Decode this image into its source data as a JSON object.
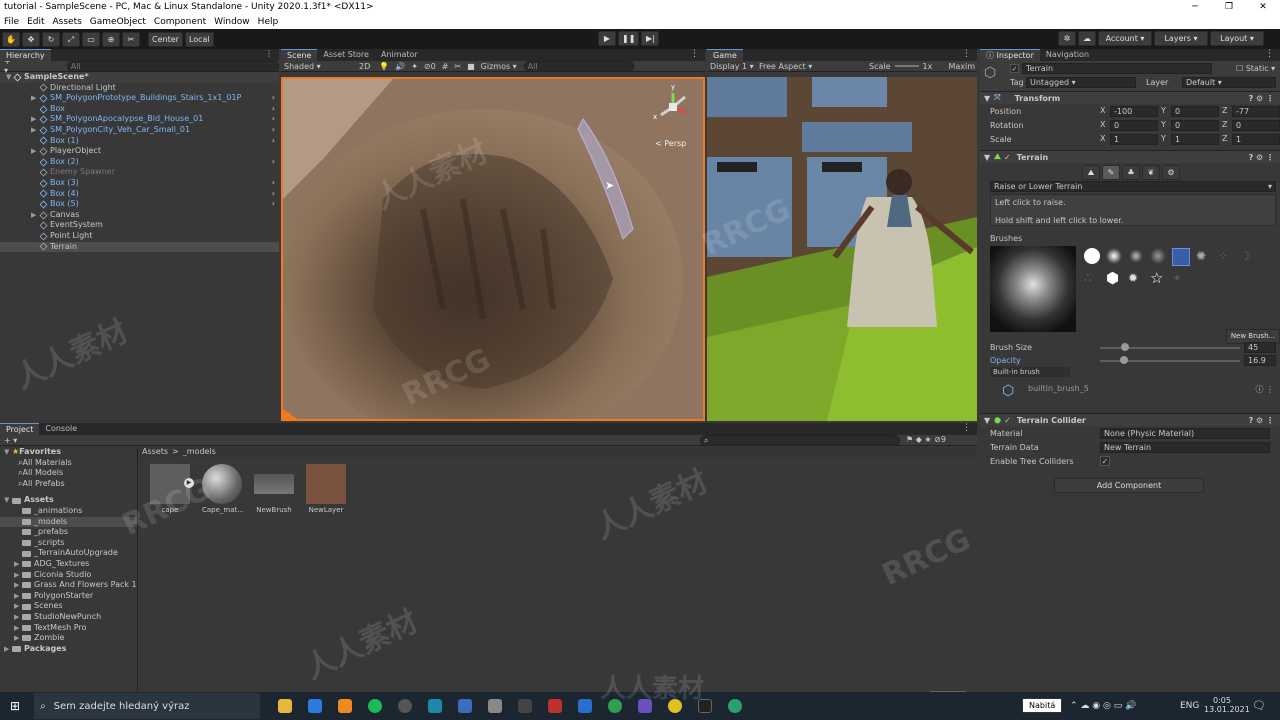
{
  "window": {
    "title": "tutorial - SampleScene - PC, Mac & Linux Standalone - Unity 2020.1.3f1* <DX11>",
    "controls": [
      "─",
      "❐",
      "✕"
    ]
  },
  "menu": [
    "File",
    "Edit",
    "Assets",
    "GameObject",
    "Component",
    "Window",
    "Help"
  ],
  "toolbar": {
    "pivot": "Center",
    "space": "Local",
    "account": "Account",
    "layers": "Layers",
    "layout": "Layout"
  },
  "hierarchy": {
    "tab": "Hierarchy",
    "search_placeholder": "All",
    "scene": "SampleScene*",
    "items": [
      {
        "label": "Directional Light",
        "kind": "normal"
      },
      {
        "label": "SM_PolygonPrototype_Buildings_Stairs_1x1_01P",
        "kind": "prefab"
      },
      {
        "label": "Box",
        "kind": "prefab"
      },
      {
        "label": "SM_PolygonApocalypse_Bld_House_01",
        "kind": "prefab"
      },
      {
        "label": "SM_PolygonCity_Veh_Car_Small_01",
        "kind": "prefab"
      },
      {
        "label": "Box (1)",
        "kind": "prefab"
      },
      {
        "label": "PlayerObject",
        "kind": "normal"
      },
      {
        "label": "Box (2)",
        "kind": "prefab"
      },
      {
        "label": "Enemy Spawner",
        "kind": "dim"
      },
      {
        "label": "Box (3)",
        "kind": "prefab"
      },
      {
        "label": "Box (4)",
        "kind": "prefab"
      },
      {
        "label": "Box (5)",
        "kind": "prefab"
      },
      {
        "label": "Canvas",
        "kind": "normal"
      },
      {
        "label": "EventSystem",
        "kind": "normal"
      },
      {
        "label": "Point Light",
        "kind": "normal"
      },
      {
        "label": "Terrain",
        "kind": "selected"
      }
    ]
  },
  "scene_view": {
    "tabs": [
      "Scene",
      "Asset Store",
      "Animator"
    ],
    "shading": "Shaded",
    "mode2d": "2D",
    "gizmos": "Gizmos",
    "search_placeholder": "All",
    "persp": "< Persp",
    "axis_y": "y",
    "axis_x": "x",
    "hidden_count": "0"
  },
  "game_view": {
    "tab": "Game",
    "display": "Display 1",
    "aspect": "Free Aspect",
    "scale_label": "Scale",
    "scale_value": "1x",
    "maximize": "Maxim"
  },
  "inspector": {
    "tabs": [
      "Inspector",
      "Navigation"
    ],
    "object_name": "Terrain",
    "static_label": "Static",
    "tag_label": "Tag",
    "tag_value": "Untagged",
    "layer_label": "Layer",
    "layer_value": "Default",
    "transform": {
      "title": "Transform",
      "position_label": "Position",
      "rotation_label": "Rotation",
      "scale_label": "Scale",
      "position": {
        "x": "-100",
        "y": "0",
        "z": "-77"
      },
      "rotation": {
        "x": "0",
        "y": "0",
        "z": "0"
      },
      "scale": {
        "x": "1",
        "y": "1",
        "z": "1"
      }
    },
    "terrain": {
      "title": "Terrain",
      "tool": "Raise or Lower Terrain",
      "help1": "Left click to raise.",
      "help2": "Hold shift and left click to lower.",
      "brushes_label": "Brushes",
      "new_brush": "New Brush...",
      "brush_size_label": "Brush Size",
      "brush_size_value": "45",
      "brush_size_fraction": 0.18,
      "opacity_label": "Opacity",
      "opacity_value": "16.9",
      "opacity_fraction": 0.169,
      "builtin_label": "Built-in brush",
      "builtin_name": "builtin_brush_5"
    },
    "collider": {
      "title": "Terrain Collider",
      "material_label": "Material",
      "material_value": "None (Physic Material)",
      "data_label": "Terrain Data",
      "data_value": "New Terrain",
      "trees_label": "Enable Tree Colliders",
      "trees_checked": "✓"
    },
    "add_component": "Add Component"
  },
  "project": {
    "tabs": [
      "Project",
      "Console"
    ],
    "favorites_label": "Favorites",
    "favorites": [
      "All Materials",
      "All Models",
      "All Prefabs"
    ],
    "assets_label": "Assets",
    "folders": [
      "_animations",
      "_models",
      "_prefabs",
      "_scripts",
      "_TerrainAutoUpgrade",
      "ADG_Textures",
      "Ciconia Studio",
      "Grass And Flowers Pack 1",
      "PolygonStarter",
      "Scenes",
      "StudioNewPunch",
      "TextMesh Pro",
      "Zombie"
    ],
    "packages_label": "Packages",
    "breadcrumb_root": "Assets",
    "breadcrumb_sep": ">",
    "breadcrumb_leaf": "_models",
    "assets": [
      "cape",
      "Cape_mat...",
      "NewBrush",
      "NewLayer"
    ],
    "hidden_count": "9"
  },
  "taskbar": {
    "search_placeholder": "Sem zadejte hledaný výraz",
    "notify": "Nabitá",
    "lang": "ENG",
    "time": "0:05",
    "date": "13.01.2021"
  },
  "watermarks": [
    "RRCG",
    "人人素材"
  ]
}
